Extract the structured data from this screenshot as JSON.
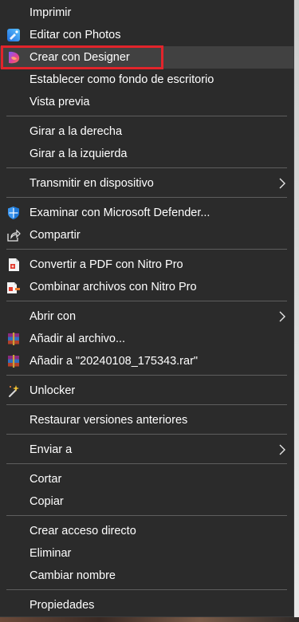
{
  "menu": {
    "items": {
      "print": "Imprimir",
      "edit_photos": "Editar con Photos",
      "create_designer": "Crear con Designer",
      "set_wallpaper": "Establecer como fondo de escritorio",
      "preview": "Vista previa",
      "rotate_right": "Girar a la derecha",
      "rotate_left": "Girar a la izquierda",
      "cast": "Transmitir en dispositivo",
      "defender": "Examinar con Microsoft Defender...",
      "share": "Compartir",
      "convert_pdf": "Convertir a PDF con Nitro Pro",
      "combine_files": "Combinar archivos con Nitro Pro",
      "open_with": "Abrir con",
      "add_archive": "Añadir al archivo...",
      "add_rar": "Añadir a \"20240108_175343.rar\"",
      "unlocker": "Unlocker",
      "restore_versions": "Restaurar versiones anteriores",
      "send_to": "Enviar a",
      "cut": "Cortar",
      "copy": "Copiar",
      "create_shortcut": "Crear acceso directo",
      "delete": "Eliminar",
      "rename": "Cambiar nombre",
      "properties": "Propiedades"
    }
  },
  "colors": {
    "menu_background": "#2b2b2b",
    "hover_background": "#414141",
    "highlight_border": "#e2242b",
    "separator": "#5e5e5e"
  },
  "icons": {
    "edit_photos": "photos-icon",
    "create_designer": "designer-icon",
    "defender": "defender-shield-icon",
    "share": "share-icon",
    "convert_pdf": "nitro-pdf-icon",
    "combine_files": "nitro-combine-icon",
    "add_archive": "winrar-icon",
    "add_rar": "winrar-icon",
    "unlocker": "magic-wand-icon",
    "submenu": "chevron-right-icon"
  }
}
